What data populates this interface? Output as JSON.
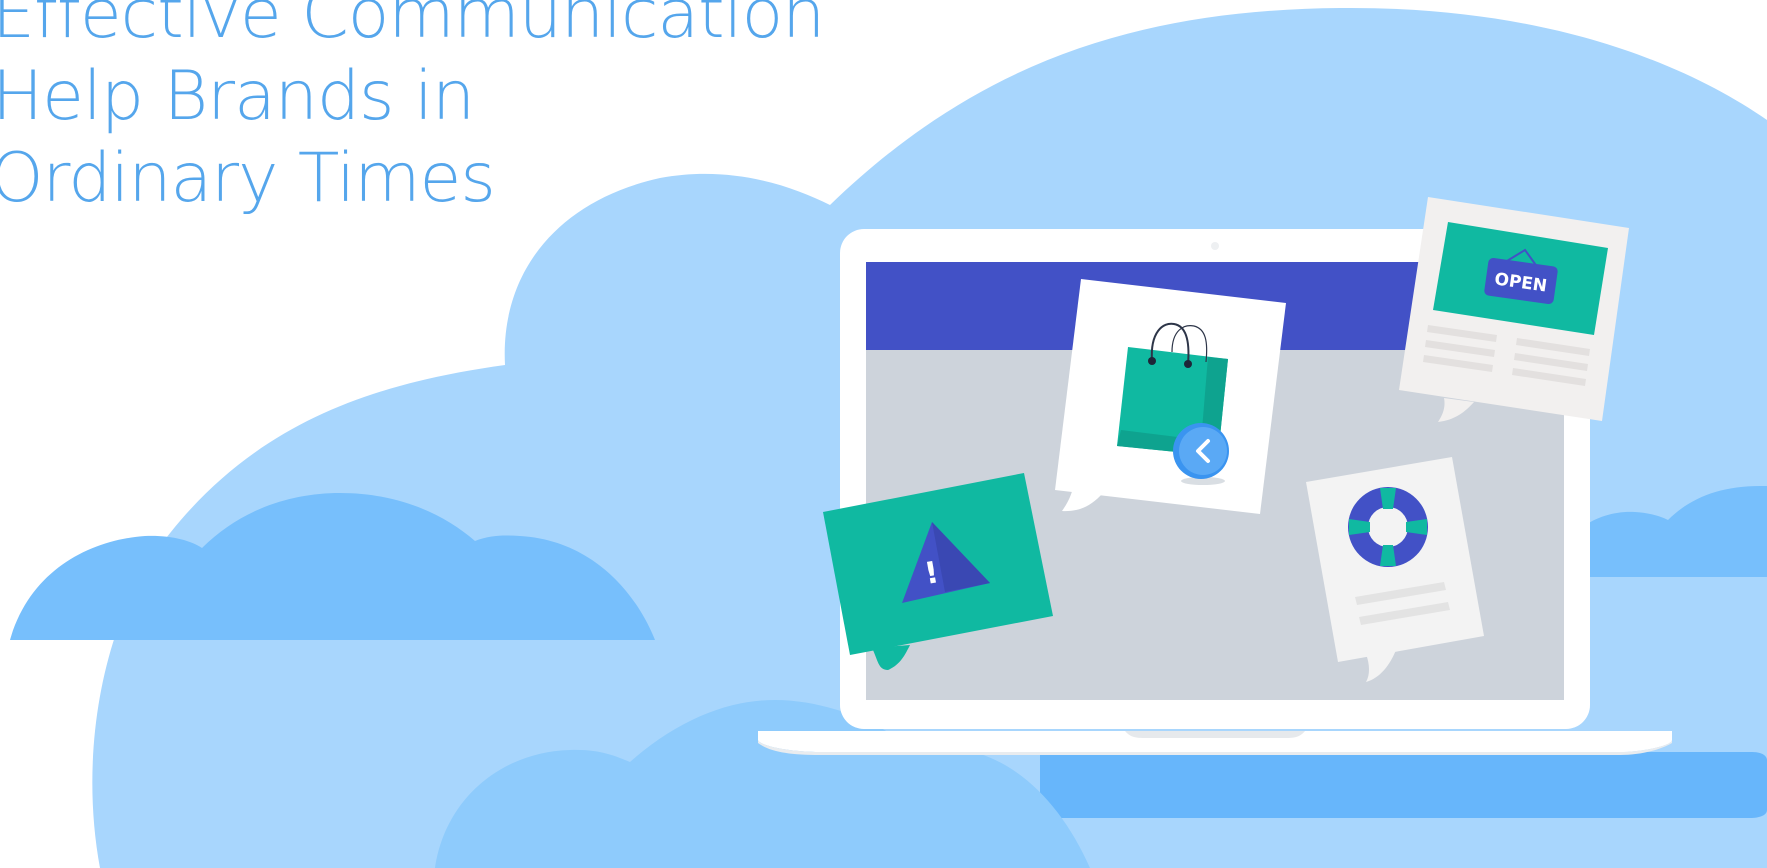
{
  "headline": {
    "line1": "Effective Communication",
    "line2": "Help Brands in",
    "line3": "Ordinary Times"
  },
  "sign": {
    "text": "OPEN"
  },
  "alert": {
    "mark": "!"
  },
  "icons": {
    "alert": "warning-triangle-icon",
    "shop": "shopping-bag-icon",
    "back": "chevron-left-icon",
    "support": "lifebuoy-icon",
    "open_sign": "open-sign-icon"
  },
  "colors": {
    "sky_light": "#a8d6fd",
    "sky_mid": "#8ecbfc",
    "cloud_dark": "#77bffc",
    "cloud_deep": "#67b6fb",
    "screen_bar": "#4251c6",
    "screen_body": "#cdd3db",
    "teal": "#10b9a1",
    "headline": "#55a6ec"
  }
}
